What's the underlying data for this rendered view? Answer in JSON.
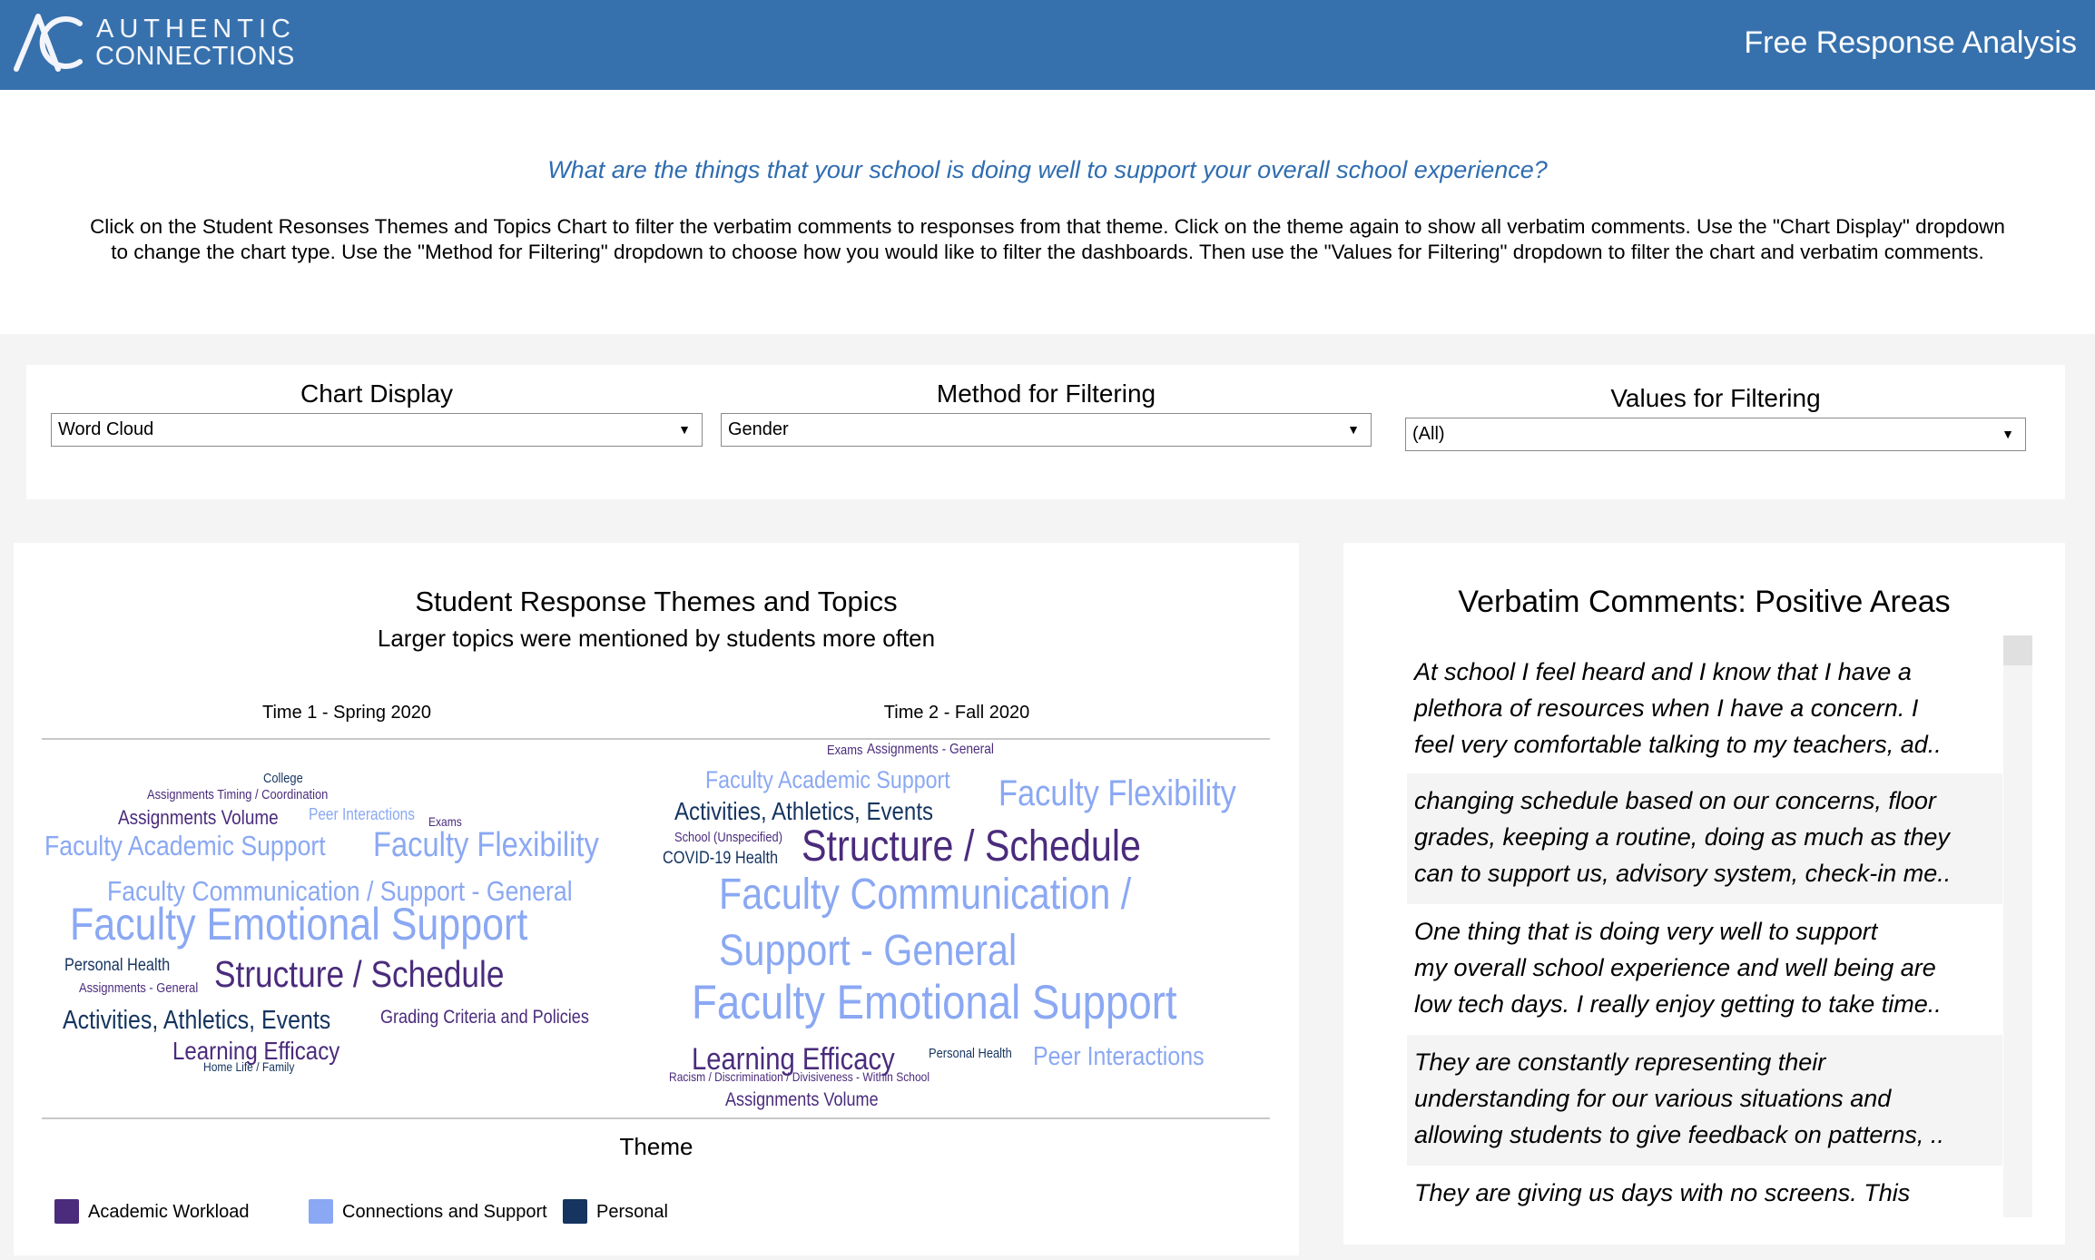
{
  "header": {
    "logo_line1": "AUTHENTIC",
    "logo_line2": "CONNECTIONS",
    "title": "Free Response Analysis",
    "background": "#3771ad"
  },
  "intro": {
    "question": "What are the things that your school is doing well to support your overall school experience?",
    "instructions": "Click on the Student Resonses Themes and Topics Chart to filter the verbatim comments to responses from that theme. Click on the theme again to show all verbatim comments. Use the \"Chart Display\" dropdown\nto change the chart type. Use the \"Method for Filtering\" dropdown to choose how you would like to filter the dashboards. Then use the \"Values for Filtering\" dropdown to filter the chart and verbatim comments."
  },
  "filters": [
    {
      "label": "Chart Display",
      "value": "Word Cloud"
    },
    {
      "label": "Method for Filtering",
      "value": "Gender"
    },
    {
      "label": "Values for Filtering",
      "value": "(All)"
    }
  ],
  "chart": {
    "title": "Student Response Themes and Topics",
    "subtitle": "Larger topics were mentioned by students more often",
    "columns": [
      "Time 1 - Spring 2020",
      "Time 2 - Fall 2020"
    ],
    "legend_title": "Theme",
    "themes": [
      {
        "name": "Academic Workload",
        "color": "#4a2b7c"
      },
      {
        "name": "Connections and Support",
        "color": "#8aa8f3"
      },
      {
        "name": "Personal",
        "color": "#15345f"
      }
    ],
    "words": [
      {
        "period": "Time 1 - Spring 2020",
        "text": "College",
        "theme": "Personal"
      },
      {
        "period": "Time 1 - Spring 2020",
        "text": "Assignments Timing / Coordination",
        "theme": "Academic Workload"
      },
      {
        "period": "Time 1 - Spring 2020",
        "text": "Assignments Volume",
        "theme": "Academic Workload"
      },
      {
        "period": "Time 1 - Spring 2020",
        "text": "Peer Interactions",
        "theme": "Connections and Support"
      },
      {
        "period": "Time 1 - Spring 2020",
        "text": "Exams",
        "theme": "Academic Workload"
      },
      {
        "period": "Time 1 - Spring 2020",
        "text": "Faculty Academic Support",
        "theme": "Connections and Support"
      },
      {
        "period": "Time 1 - Spring 2020",
        "text": "Faculty Flexibility",
        "theme": "Connections and Support"
      },
      {
        "period": "Time 1 - Spring 2020",
        "text": "Faculty Communication / Support - General",
        "theme": "Connections and Support"
      },
      {
        "period": "Time 1 - Spring 2020",
        "text": "Faculty Emotional Support",
        "theme": "Connections and Support"
      },
      {
        "period": "Time 1 - Spring 2020",
        "text": "Personal Health",
        "theme": "Personal"
      },
      {
        "period": "Time 1 - Spring 2020",
        "text": "Assignments - General",
        "theme": "Academic Workload"
      },
      {
        "period": "Time 1 - Spring 2020",
        "text": "Structure / Schedule",
        "theme": "Academic Workload"
      },
      {
        "period": "Time 1 - Spring 2020",
        "text": "Activities, Athletics, Events",
        "theme": "Personal"
      },
      {
        "period": "Time 1 - Spring 2020",
        "text": "Grading Criteria and Policies",
        "theme": "Academic Workload"
      },
      {
        "period": "Time 1 - Spring 2020",
        "text": "Learning Efficacy",
        "theme": "Academic Workload"
      },
      {
        "period": "Time 1 - Spring 2020",
        "text": "Home Life / Family",
        "theme": "Personal"
      },
      {
        "period": "Time 2 - Fall 2020",
        "text": "Exams",
        "theme": "Academic Workload"
      },
      {
        "period": "Time 2 - Fall 2020",
        "text": "Assignments - General",
        "theme": "Academic Workload"
      },
      {
        "period": "Time 2 - Fall 2020",
        "text": "Faculty Academic Support",
        "theme": "Connections and Support"
      },
      {
        "period": "Time 2 - Fall 2020",
        "text": "Faculty Flexibility",
        "theme": "Connections and Support"
      },
      {
        "period": "Time 2 - Fall 2020",
        "text": "Activities, Athletics, Events",
        "theme": "Personal"
      },
      {
        "period": "Time 2 - Fall 2020",
        "text": "School (Unspecified)",
        "theme": "Academic Workload"
      },
      {
        "period": "Time 2 - Fall 2020",
        "text": "COVID-19 Health",
        "theme": "Personal"
      },
      {
        "period": "Time 2 - Fall 2020",
        "text": "Structure / Schedule",
        "theme": "Academic Workload"
      },
      {
        "period": "Time 2 - Fall 2020",
        "text": "Faculty Communication /",
        "theme": "Connections and Support"
      },
      {
        "period": "Time 2 - Fall 2020",
        "text": "Support - General",
        "theme": "Connections and Support"
      },
      {
        "period": "Time 2 - Fall 2020",
        "text": "Faculty Emotional Support",
        "theme": "Connections and Support"
      },
      {
        "period": "Time 2 - Fall 2020",
        "text": "Learning Efficacy",
        "theme": "Academic Workload"
      },
      {
        "period": "Time 2 - Fall 2020",
        "text": "Personal Health",
        "theme": "Personal"
      },
      {
        "period": "Time 2 - Fall 2020",
        "text": "Peer Interactions",
        "theme": "Connections and Support"
      },
      {
        "period": "Time 2 - Fall 2020",
        "text": "Racism / Discrimination / Divisiveness - Within School",
        "theme": "Academic Workload"
      },
      {
        "period": "Time 2 - Fall 2020",
        "text": "Assignments Volume",
        "theme": "Academic Workload"
      }
    ]
  },
  "comments": {
    "title": "Verbatim Comments: Positive Areas",
    "items": [
      "At school I feel heard and I know that I have a\nplethora of resources when I have a concern. I\nfeel very comfortable talking to my teachers, ad..",
      "changing schedule based on our concerns, floor\ngrades, keeping a routine, doing as much as they\ncan to support us, advisory system, check-in me..",
      "One thing that        is doing very well to support\nmy overall school experience and well being are\nlow tech days. I really enjoy getting to take time..",
      "They are constantly representing their\nunderstanding for our various situations and\nallowing students to give feedback on patterns, ..",
      "They are giving us days with no screens. This"
    ]
  }
}
